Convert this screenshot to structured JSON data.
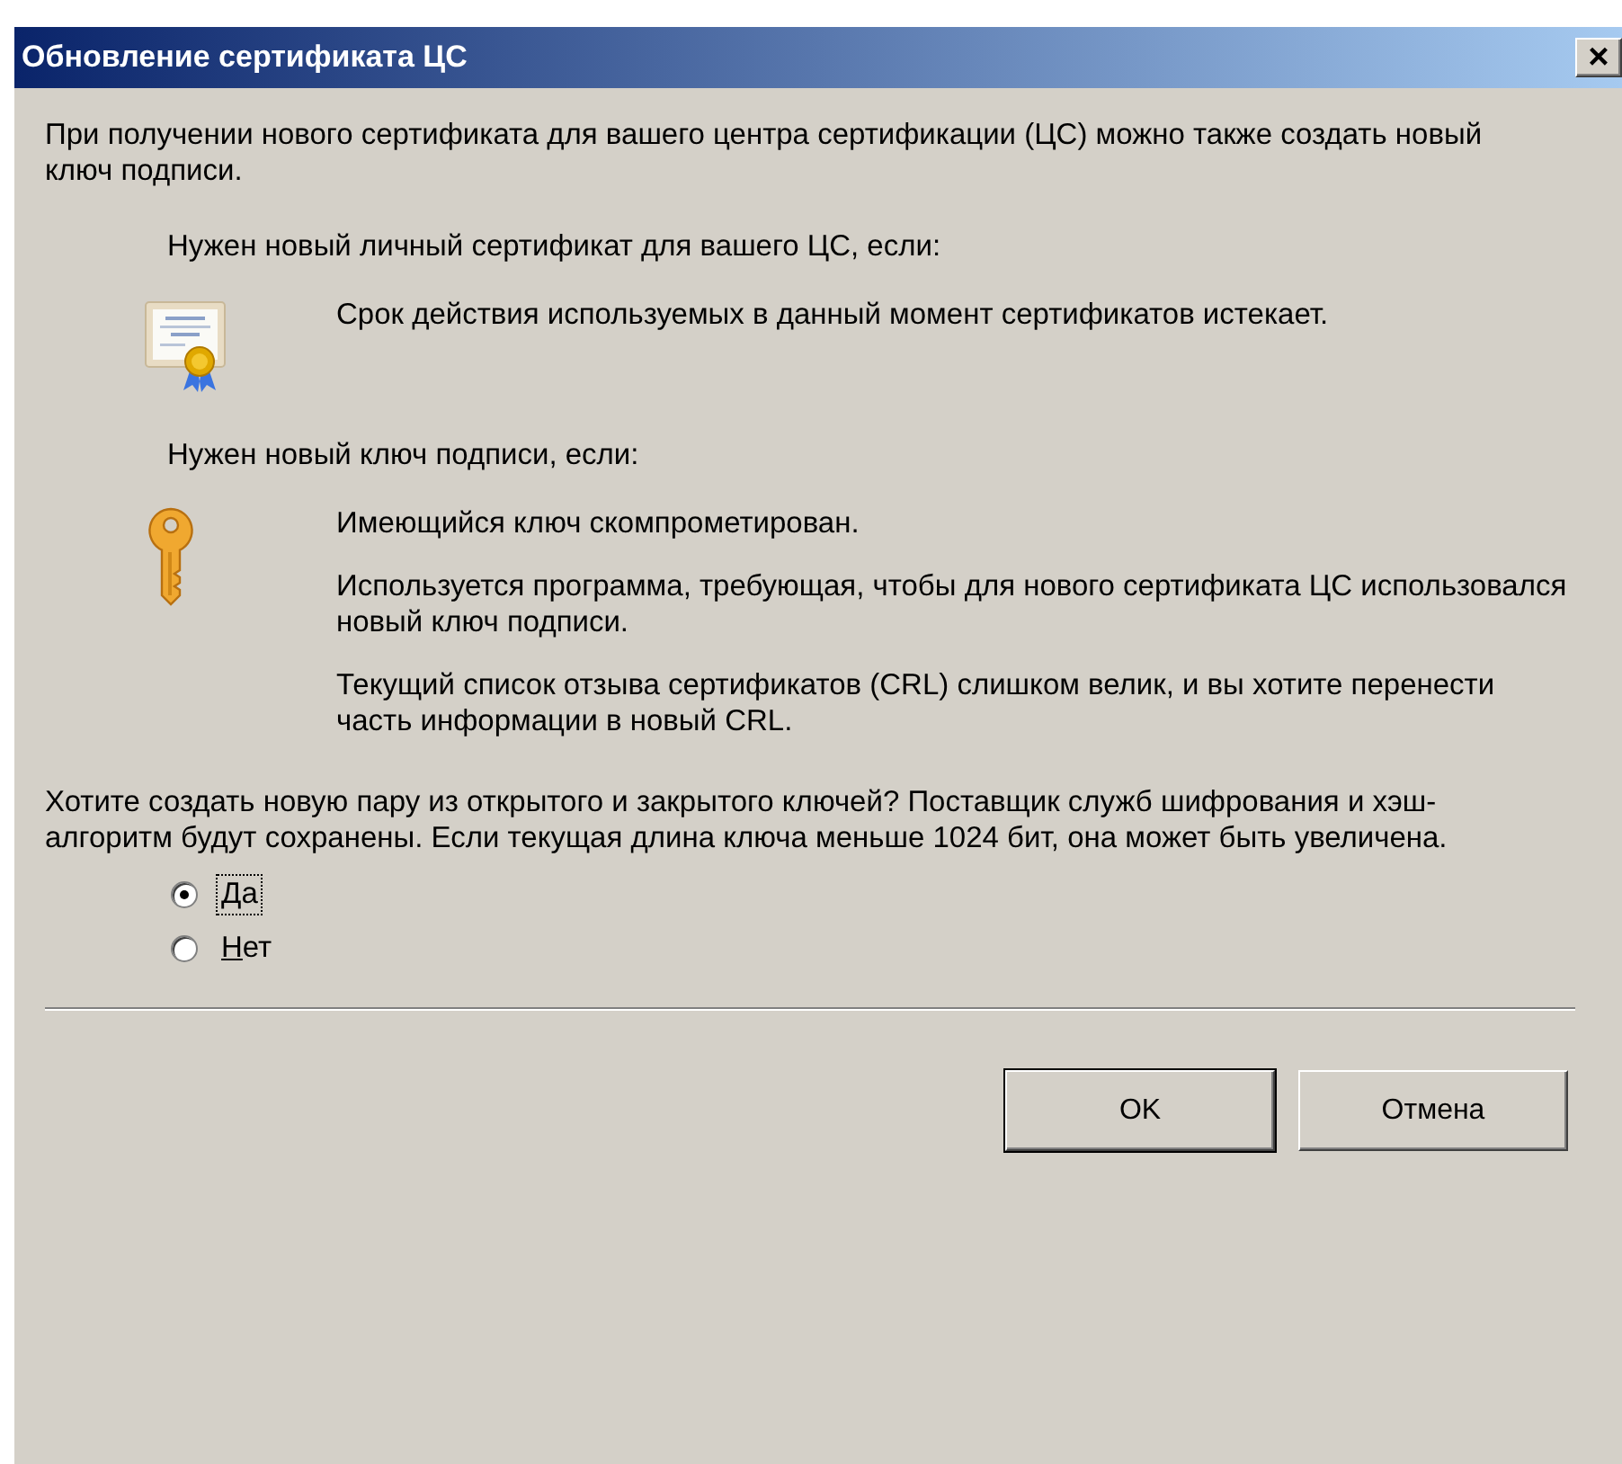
{
  "window": {
    "title": "Обновление сертификата ЦС",
    "close": "×"
  },
  "intro": "При получении нового сертификата для вашего центра сертификации (ЦС) можно также создать новый ключ подписи.",
  "sections": [
    {
      "heading": "Нужен новый личный сертификат для вашего ЦС, если:",
      "kind": "certificate",
      "reasons": [
        "Срок действия используемых в данный момент сертификатов истекает."
      ]
    },
    {
      "heading": "Нужен новый ключ подписи, если:",
      "kind": "key",
      "reasons": [
        "Имеющийся ключ скомпрометирован.",
        "Используется программа, требующая, чтобы для нового сертификата ЦС использовался новый ключ подписи.",
        "Текущий список отзыва сертификатов (CRL) слишком велик, и вы хотите перенести часть информации в новый CRL."
      ]
    }
  ],
  "question": "Хотите создать новую пару из открытого и закрытого ключей? Поставщик служб шифрования и хэш-алгоритм будут сохранены. Если текущая длина ключа меньше 1024 бит, она может быть увеличена.",
  "options": [
    {
      "label": "Да",
      "selected": true,
      "focused": true
    },
    {
      "label": "Нет",
      "selected": false,
      "focused": false
    }
  ],
  "buttons": [
    {
      "label": "OK",
      "default": true
    },
    {
      "label": "Отмена",
      "default": false
    }
  ]
}
